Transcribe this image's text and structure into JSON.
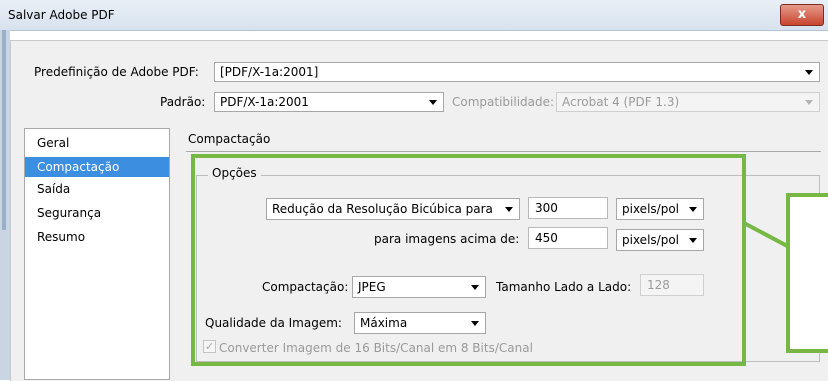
{
  "window": {
    "title": "Salvar Adobe PDF",
    "close_glyph": "x"
  },
  "preset": {
    "label": "Predefinição de Adobe PDF:",
    "value": "[PDF/X-1a:2001]"
  },
  "standard": {
    "label": "Padrão:",
    "value": "PDF/X-1a:2001"
  },
  "compatibility": {
    "label": "Compatibilidade:",
    "value": "Acrobat 4 (PDF 1.3)"
  },
  "sidebar": {
    "items": [
      {
        "label": "Geral",
        "selected": false
      },
      {
        "label": "Compactação",
        "selected": true
      },
      {
        "label": "Saída",
        "selected": false
      },
      {
        "label": "Segurança",
        "selected": false
      },
      {
        "label": "Resumo",
        "selected": false
      }
    ]
  },
  "section": {
    "title": "Compactação"
  },
  "options": {
    "group_title": "Opções",
    "resample": {
      "value": "Redução da Resolução Bicúbica para",
      "ppi": "300",
      "unit": "pixels/pol"
    },
    "above": {
      "label": "para imagens acima de:",
      "ppi": "450",
      "unit": "pixels/pol"
    },
    "compression": {
      "label": "Compactação:",
      "value": "JPEG"
    },
    "tile_size": {
      "label": "Tamanho Lado a Lado:",
      "value": "128"
    },
    "quality": {
      "label": "Qualidade da Imagem:",
      "value": "Máxima"
    },
    "convert": {
      "label": "Converter Imagem de 16 Bits/Canal em 8 Bits/Canal",
      "checked": true,
      "check_glyph": "✓"
    }
  },
  "colors": {
    "highlight": "#77b845",
    "selection": "#3c8ee0"
  }
}
